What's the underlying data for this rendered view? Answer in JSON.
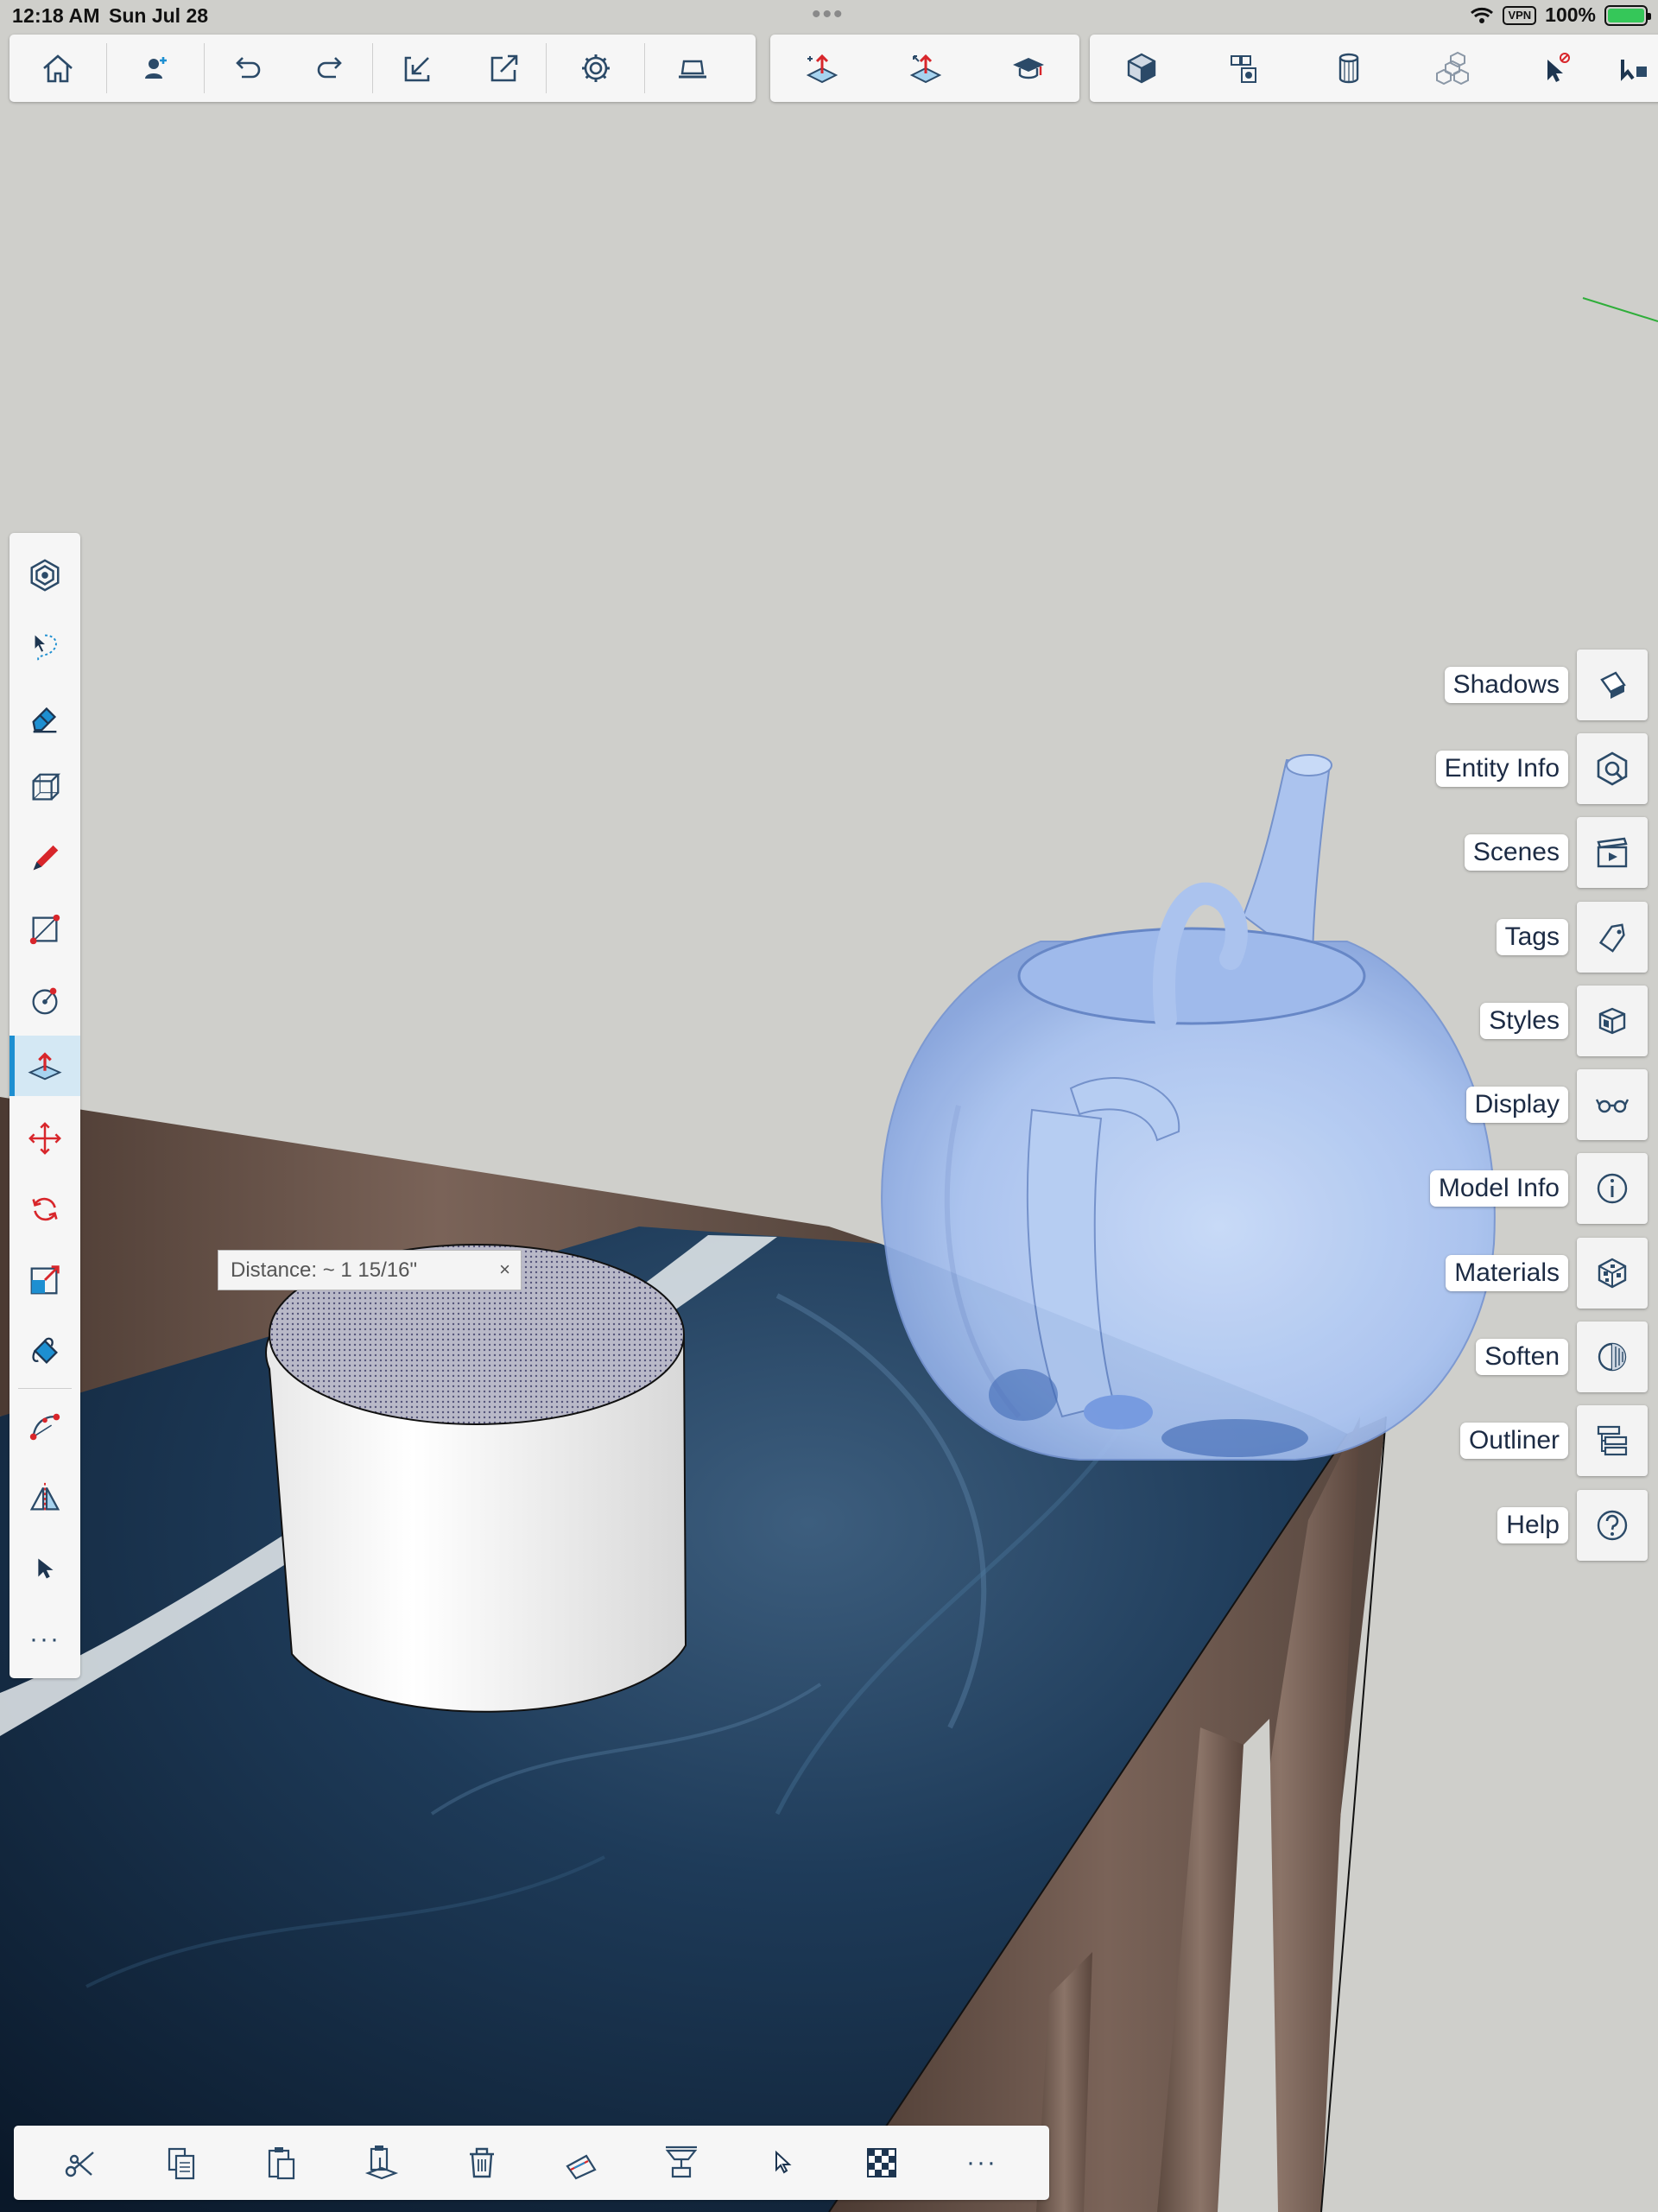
{
  "status_bar": {
    "time": "12:18 AM",
    "date": "Sun Jul 28",
    "vpn": "VPN",
    "battery": "100%",
    "battery_color": "#35c759"
  },
  "top_toolbar": {
    "group1": [
      {
        "icon": "home-icon"
      },
      {
        "icon": "add-person-icon"
      },
      {
        "icon": "undo-icon"
      },
      {
        "icon": "redo-icon"
      },
      {
        "icon": "import-icon"
      },
      {
        "icon": "export-icon"
      },
      {
        "icon": "settings-gear-icon"
      },
      {
        "icon": "laptop-icon"
      }
    ],
    "group2": [
      {
        "icon": "push-pull-icon"
      },
      {
        "icon": "push-pull-move-icon"
      },
      {
        "icon": "graduation-cap-icon"
      }
    ],
    "group3": [
      {
        "icon": "cube-icon"
      },
      {
        "icon": "components-icon"
      },
      {
        "icon": "cylinder-icon"
      },
      {
        "icon": "cubes-icon"
      },
      {
        "icon": "select-cursor-icon"
      },
      {
        "icon": "partial-tool-icon"
      }
    ]
  },
  "left_tools": [
    {
      "icon": "component-icon"
    },
    {
      "icon": "lasso-select-icon"
    },
    {
      "icon": "eraser-icon"
    },
    {
      "icon": "box-shape-icon"
    },
    {
      "icon": "pencil-icon"
    },
    {
      "icon": "rectangle-icon"
    },
    {
      "icon": "circle-icon"
    },
    {
      "icon": "push-pull-icon",
      "active": true
    },
    {
      "icon": "move-icon"
    },
    {
      "icon": "rotate-icon"
    },
    {
      "icon": "scale-icon"
    },
    {
      "icon": "paint-bucket-icon"
    },
    {
      "icon": "arc-icon"
    },
    {
      "icon": "mirror-icon"
    },
    {
      "icon": "select-arrow-icon"
    },
    {
      "icon": "more-icon",
      "label": "···"
    }
  ],
  "side_panels": [
    {
      "label": "Shadows",
      "icon": "shadows-icon"
    },
    {
      "label": "Entity Info",
      "icon": "entity-info-icon"
    },
    {
      "label": "Scenes",
      "icon": "scenes-icon"
    },
    {
      "label": "Tags",
      "icon": "tag-icon"
    },
    {
      "label": "Styles",
      "icon": "styles-icon"
    },
    {
      "label": "Display",
      "icon": "glasses-icon"
    },
    {
      "label": "Model Info",
      "icon": "info-icon"
    },
    {
      "label": "Materials",
      "icon": "materials-icon"
    },
    {
      "label": "Soften",
      "icon": "soften-icon"
    },
    {
      "label": "Outliner",
      "icon": "outliner-icon"
    },
    {
      "label": "Help",
      "icon": "help-icon"
    }
  ],
  "measurement": {
    "text": "Distance: ~ 1 15/16\"",
    "close": "×"
  },
  "bottom_toolbar": [
    {
      "icon": "scissors-icon"
    },
    {
      "icon": "copy-icon"
    },
    {
      "icon": "paste-icon"
    },
    {
      "icon": "paste-in-place-icon"
    },
    {
      "icon": "trash-icon"
    },
    {
      "icon": "dimension-icon"
    },
    {
      "icon": "section-plane-icon"
    },
    {
      "icon": "cursor-icon"
    },
    {
      "icon": "checker-icon"
    },
    {
      "icon": "ellipsis-icon",
      "label": "···"
    }
  ],
  "colors": {
    "accent": "#1d8fd1",
    "icon_dark": "#2b4a68",
    "teapot": "#a8c4f2",
    "table_top": "#0f2238",
    "wood": "#6b5448"
  }
}
